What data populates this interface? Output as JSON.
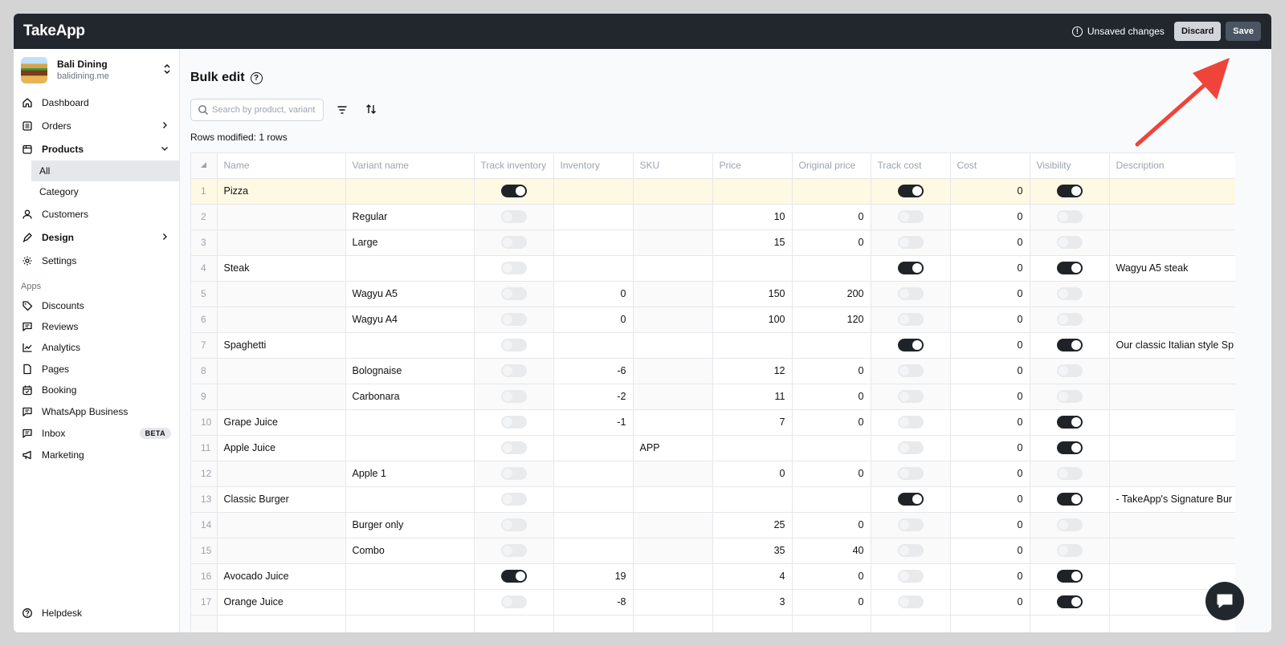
{
  "app": {
    "logo": "TakeApp",
    "unsaved_text": "Unsaved changes",
    "discard_label": "Discard",
    "save_label": "Save"
  },
  "store": {
    "name": "Bali Dining",
    "domain": "balidining.me"
  },
  "nav": {
    "dashboard": "Dashboard",
    "orders": "Orders",
    "products": "Products",
    "products_all": "All",
    "products_category": "Category",
    "customers": "Customers",
    "design": "Design",
    "settings": "Settings",
    "apps_label": "Apps",
    "discounts": "Discounts",
    "reviews": "Reviews",
    "analytics": "Analytics",
    "pages": "Pages",
    "booking": "Booking",
    "whatsapp": "WhatsApp Business",
    "inbox": "Inbox",
    "inbox_badge": "BETA",
    "marketing": "Marketing",
    "helpdesk": "Helpdesk"
  },
  "page": {
    "title": "Bulk edit",
    "search_placeholder": "Search by product, variant",
    "rows_modified": "Rows modified: 1 rows"
  },
  "table": {
    "columns": [
      "Name",
      "Variant name",
      "Track inventory",
      "Inventory",
      "SKU",
      "Price",
      "Original price",
      "Track cost",
      "Cost",
      "Visibility",
      "Description"
    ],
    "rows": [
      {
        "n": "1",
        "name": "Pizza",
        "variant": "",
        "track_inv": true,
        "inv": "",
        "sku": "",
        "price": "",
        "orig": "",
        "track_cost": true,
        "cost": "0",
        "vis": true,
        "desc": "",
        "parent": true,
        "highlight": true
      },
      {
        "n": "2",
        "name": "",
        "variant": "Regular",
        "track_inv": false,
        "inv": "",
        "sku": "",
        "price": "10",
        "orig": "0",
        "track_cost": false,
        "cost": "0",
        "vis": false,
        "desc": "",
        "parent": false
      },
      {
        "n": "3",
        "name": "",
        "variant": "Large",
        "track_inv": false,
        "inv": "",
        "sku": "",
        "price": "15",
        "orig": "0",
        "track_cost": false,
        "cost": "0",
        "vis": false,
        "desc": "",
        "parent": false
      },
      {
        "n": "4",
        "name": "Steak",
        "variant": "",
        "track_inv": false,
        "inv": "",
        "sku": "",
        "price": "",
        "orig": "",
        "track_cost": true,
        "cost": "0",
        "vis": true,
        "desc": "Wagyu A5 steak",
        "parent": true
      },
      {
        "n": "5",
        "name": "",
        "variant": "Wagyu A5",
        "track_inv": false,
        "inv": "0",
        "sku": "",
        "price": "150",
        "orig": "200",
        "track_cost": false,
        "cost": "0",
        "vis": false,
        "desc": "",
        "parent": false
      },
      {
        "n": "6",
        "name": "",
        "variant": "Wagyu A4",
        "track_inv": false,
        "inv": "0",
        "sku": "",
        "price": "100",
        "orig": "120",
        "track_cost": false,
        "cost": "0",
        "vis": false,
        "desc": "",
        "parent": false
      },
      {
        "n": "7",
        "name": "Spaghetti",
        "variant": "",
        "track_inv": false,
        "inv": "",
        "sku": "",
        "price": "",
        "orig": "",
        "track_cost": true,
        "cost": "0",
        "vis": true,
        "desc": "Our classic Italian style Sp",
        "parent": true
      },
      {
        "n": "8",
        "name": "",
        "variant": "Bolognaise",
        "track_inv": false,
        "inv": "-6",
        "sku": "",
        "price": "12",
        "orig": "0",
        "track_cost": false,
        "cost": "0",
        "vis": false,
        "desc": "",
        "parent": false
      },
      {
        "n": "9",
        "name": "",
        "variant": "Carbonara",
        "track_inv": false,
        "inv": "-2",
        "sku": "",
        "price": "11",
        "orig": "0",
        "track_cost": false,
        "cost": "0",
        "vis": false,
        "desc": "",
        "parent": false
      },
      {
        "n": "10",
        "name": "Grape Juice",
        "variant": "",
        "track_inv": false,
        "inv": "-1",
        "sku": "",
        "price": "7",
        "orig": "0",
        "track_cost": false,
        "cost": "0",
        "vis": true,
        "desc": "",
        "parent": true
      },
      {
        "n": "11",
        "name": "Apple Juice",
        "variant": "",
        "track_inv": false,
        "inv": "",
        "sku": "APP",
        "price": "",
        "orig": "",
        "track_cost": false,
        "cost": "0",
        "vis": true,
        "desc": "",
        "parent": true
      },
      {
        "n": "12",
        "name": "",
        "variant": "Apple 1",
        "track_inv": false,
        "inv": "",
        "sku": "",
        "price": "0",
        "orig": "0",
        "track_cost": false,
        "cost": "0",
        "vis": false,
        "desc": "",
        "parent": false
      },
      {
        "n": "13",
        "name": "Classic Burger",
        "variant": "",
        "track_inv": false,
        "inv": "",
        "sku": "",
        "price": "",
        "orig": "",
        "track_cost": true,
        "cost": "0",
        "vis": true,
        "desc": "- TakeApp's Signature Bur",
        "parent": true
      },
      {
        "n": "14",
        "name": "",
        "variant": "Burger only",
        "track_inv": false,
        "inv": "",
        "sku": "",
        "price": "25",
        "orig": "0",
        "track_cost": false,
        "cost": "0",
        "vis": false,
        "desc": "",
        "parent": false
      },
      {
        "n": "15",
        "name": "",
        "variant": "Combo",
        "track_inv": false,
        "inv": "",
        "sku": "",
        "price": "35",
        "orig": "40",
        "track_cost": false,
        "cost": "0",
        "vis": false,
        "desc": "",
        "parent": false
      },
      {
        "n": "16",
        "name": "Avocado Juice",
        "variant": "",
        "track_inv": true,
        "inv": "19",
        "sku": "",
        "price": "4",
        "orig": "0",
        "track_cost": false,
        "cost": "0",
        "vis": true,
        "desc": "",
        "parent": true
      },
      {
        "n": "17",
        "name": "Orange Juice",
        "variant": "",
        "track_inv": false,
        "inv": "-8",
        "sku": "",
        "price": "3",
        "orig": "0",
        "track_cost": false,
        "cost": "0",
        "vis": true,
        "desc": "",
        "parent": true
      },
      {
        "n": "",
        "name": "",
        "variant": "",
        "track_inv": false,
        "inv": "",
        "sku": "",
        "price": "",
        "orig": "",
        "track_cost": false,
        "cost": "",
        "vis": false,
        "desc": "",
        "parent": true,
        "blank": true
      }
    ]
  },
  "colors": {
    "topbar": "#22272e",
    "highlight_row": "#fef9e3",
    "annotation_arrow": "#f0433a"
  }
}
